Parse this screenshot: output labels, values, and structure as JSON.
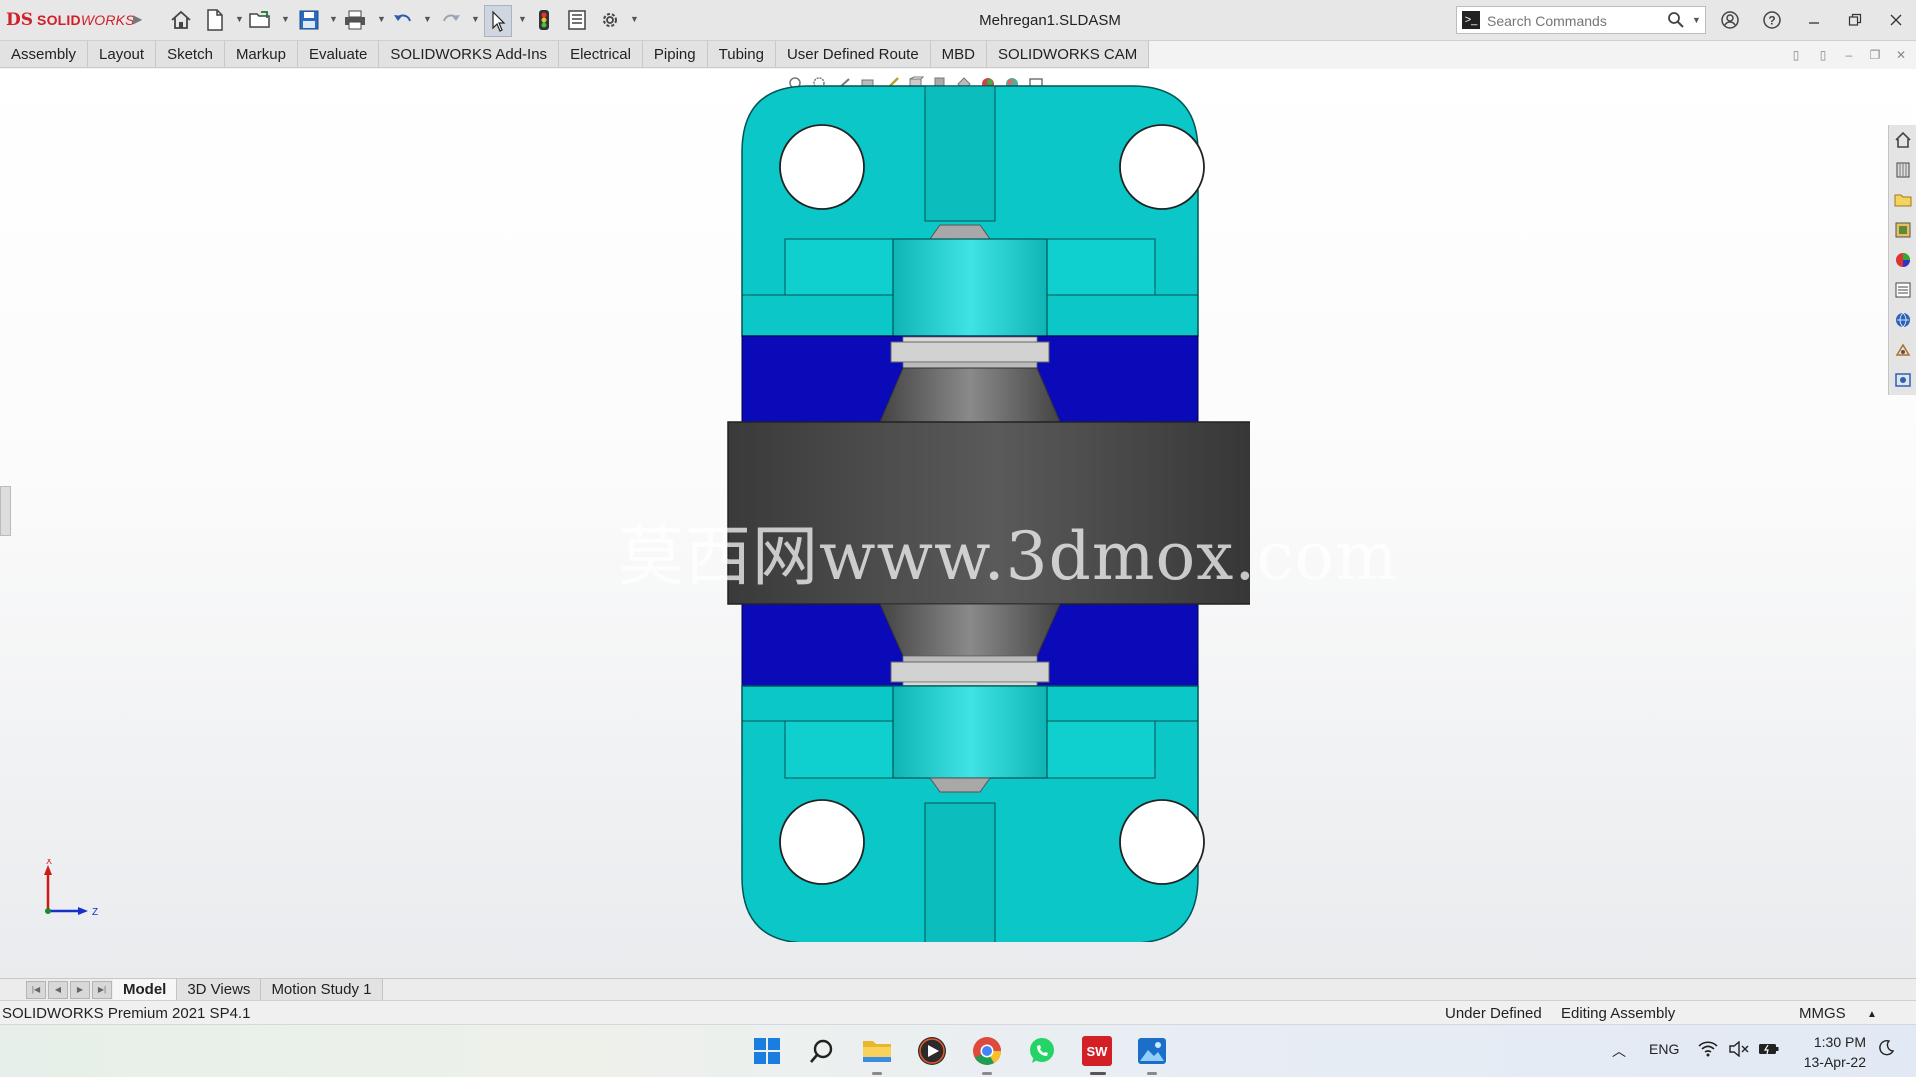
{
  "app": {
    "brand_ds": "DS",
    "brand_solid": "SOLID",
    "brand_works": "WORKS"
  },
  "document": {
    "title": "Mehregan1.SLDASM"
  },
  "search": {
    "placeholder": "Search Commands"
  },
  "tabs": [
    {
      "label": "Assembly"
    },
    {
      "label": "Layout"
    },
    {
      "label": "Sketch"
    },
    {
      "label": "Markup"
    },
    {
      "label": "Evaluate"
    },
    {
      "label": "SOLIDWORKS Add-Ins"
    },
    {
      "label": "Electrical"
    },
    {
      "label": "Piping"
    },
    {
      "label": "Tubing"
    },
    {
      "label": "User Defined Route"
    },
    {
      "label": "MBD"
    },
    {
      "label": "SOLIDWORKS CAM"
    }
  ],
  "viewport": {
    "watermark": "莫西网www.3dmox.com",
    "triad": {
      "x_label": "X",
      "z_label": "Z"
    },
    "colors": {
      "teal": "#0cc7c7",
      "blue": "#0a0ab8",
      "dark_gray": "#4a4a4a",
      "light_gray": "#c9c9c9"
    }
  },
  "bottom_tabs": [
    {
      "label": "Model",
      "active": true
    },
    {
      "label": "3D Views",
      "active": false
    },
    {
      "label": "Motion Study 1",
      "active": false
    }
  ],
  "status": {
    "version": "SOLIDWORKS Premium 2021 SP4.1",
    "definition": "Under Defined",
    "mode": "Editing Assembly",
    "units": "MMGS"
  },
  "taskbar": {
    "language": "ENG",
    "time": "1:30 PM",
    "date": "13-Apr-22",
    "sw_badge": "SW"
  }
}
